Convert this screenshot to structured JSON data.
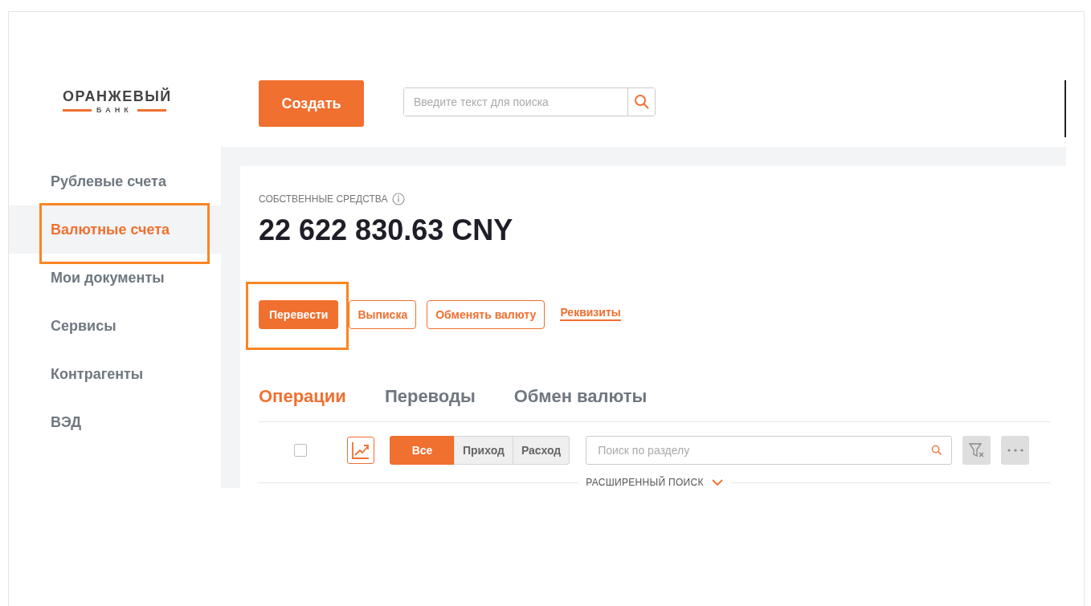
{
  "logo": {
    "name": "ОРАНЖЕВЫЙ",
    "subtitle": "БАНК"
  },
  "header": {
    "create_button": "Создать",
    "search": {
      "placeholder": "Введите текст для поиска"
    }
  },
  "sidebar": {
    "items": [
      {
        "label": "Рублевые счета",
        "selected": false,
        "highlighted": false
      },
      {
        "label": "Валютные счета",
        "selected": true,
        "highlighted": true
      },
      {
        "label": "Мои документы",
        "selected": false,
        "highlighted": false
      },
      {
        "label": "Сервисы",
        "selected": false,
        "highlighted": false
      },
      {
        "label": "Контрагенты",
        "selected": false,
        "highlighted": false
      },
      {
        "label": "ВЭД",
        "selected": false,
        "highlighted": false
      }
    ]
  },
  "balance": {
    "label": "СОБСТВЕННЫЕ СРЕДСТВА",
    "amount": "22 622 830.63 CNY"
  },
  "actions": [
    {
      "kind": "primary",
      "label": "Перевести",
      "highlighted": true
    },
    {
      "kind": "outline",
      "label": "Выписка",
      "highlighted": false
    },
    {
      "kind": "outline",
      "label": "Обменять валюту",
      "highlighted": false
    },
    {
      "kind": "link",
      "label": "Реквизиты",
      "highlighted": false
    }
  ],
  "tabs": [
    {
      "label": "Операции",
      "selected": true
    },
    {
      "label": "Переводы",
      "selected": false
    },
    {
      "label": "Обмен валюты",
      "selected": false
    }
  ],
  "toolbar": {
    "select_all_checked": false,
    "filters": [
      {
        "label": "Все",
        "selected": true
      },
      {
        "label": "Приход",
        "selected": false
      },
      {
        "label": "Расход",
        "selected": false
      }
    ],
    "search": {
      "placeholder": "Поиск по разделу"
    },
    "advanced_search": "РАСШИРЕННЫЙ ПОИСК"
  }
}
